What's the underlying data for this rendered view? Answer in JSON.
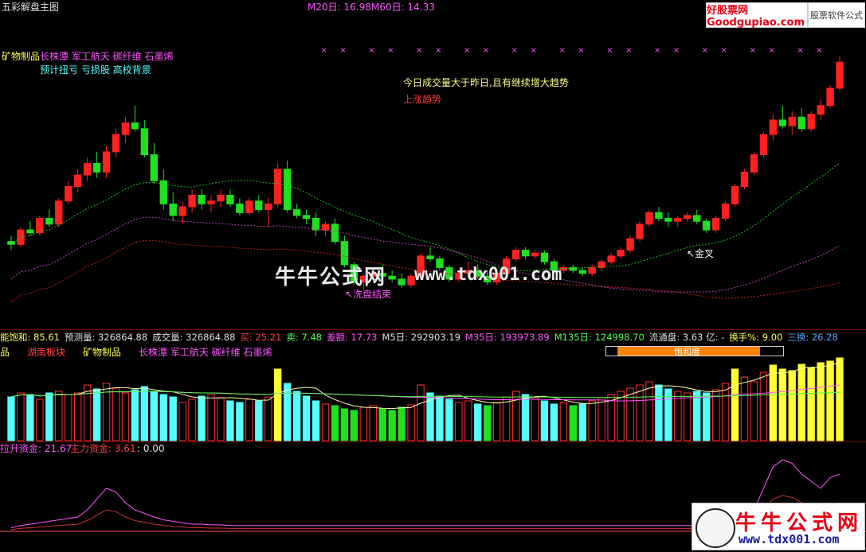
{
  "title": "五彩解盘主图",
  "header_ma": {
    "m20": "M20日: 16.98",
    "m60": "M60日: 14.33"
  },
  "banner": {
    "left": "好股票网Goodgupiao.com",
    "right": "股票软件公式"
  },
  "concepts1": {
    "first": "矿物制品",
    "rest": "长株潭 军工航天 碳纤维 石墨烯"
  },
  "concepts2": "预计扭亏 亏损股 高校背景",
  "notes": {
    "line1": "今日成交量大于昨日,且有继续增大趋势",
    "line2": "上涨趋势"
  },
  "annotations": {
    "wash": "↖洗盘结束",
    "golden": "↖金叉"
  },
  "watermark": {
    "cn": "牛牛公式网",
    "url": "www.tdx001.com"
  },
  "info_bar": [
    {
      "label": "能饱和: ",
      "value": "85.61",
      "color": "#ffff55"
    },
    {
      "label": "预测量: ",
      "value": "326864.88",
      "color": "#e0e0e0"
    },
    {
      "label": "成交量: ",
      "value": "326864.88",
      "color": "#e0e0e0"
    },
    {
      "label": "买: ",
      "value": "25.21",
      "color": "#ff4040"
    },
    {
      "label": "卖: ",
      "value": "7.48",
      "color": "#55ff55"
    },
    {
      "label": "差额: ",
      "value": "17.73",
      "color": "#ff55ff"
    },
    {
      "label": "M5日: ",
      "value": "292903.19",
      "color": "#e0e0e0"
    },
    {
      "label": "M35日: ",
      "value": "193973.89",
      "color": "#ff55ff"
    },
    {
      "label": "M135日: ",
      "value": "124998.70",
      "color": "#55ff55"
    },
    {
      "label": "流通盘: ",
      "value": "3.63 亿: -",
      "color": "#e0e0e0"
    },
    {
      "label": "换手%: ",
      "value": "9.00",
      "color": "#ffff55"
    },
    {
      "label": "三换: ",
      "value": "26.28",
      "color": "#55aaff"
    }
  ],
  "sector_bar": [
    {
      "text": "品",
      "color": "#ffff55"
    },
    {
      "text": "湖南板块",
      "color": "#ff4040"
    },
    {
      "text": "矿物制品",
      "color": "#ffff55"
    },
    {
      "text": "长株潭 军工航天 碳纤维 石墨烯",
      "color": "#ff55ff"
    }
  ],
  "saturation": {
    "label": "饱和度",
    "fill_fraction": 0.86
  },
  "fund_bar": {
    "a": "拉升资金: 21.67",
    "b": "主力资金: 3.61",
    "c": ": 0.00"
  },
  "colors": {
    "up": "#ff2020",
    "down": "#20e020",
    "ma20": "#20c020",
    "ma60": "#c040c0",
    "ma120": "#c02020"
  },
  "chart_data": {
    "type": "candlestick",
    "ma20": 16.98,
    "ma60": 14.33,
    "candles": [
      [
        13.1,
        13.3,
        12.8,
        13.0
      ],
      [
        13.0,
        13.6,
        12.9,
        13.5
      ],
      [
        13.5,
        13.8,
        13.3,
        13.4
      ],
      [
        13.4,
        14.0,
        13.3,
        13.9
      ],
      [
        13.9,
        14.2,
        13.6,
        13.7
      ],
      [
        13.7,
        14.6,
        13.6,
        14.5
      ],
      [
        14.5,
        15.2,
        14.4,
        15.0
      ],
      [
        15.0,
        15.6,
        14.8,
        15.4
      ],
      [
        15.4,
        16.0,
        15.2,
        15.8
      ],
      [
        15.8,
        16.2,
        15.3,
        15.5
      ],
      [
        15.5,
        16.4,
        15.3,
        16.2
      ],
      [
        16.2,
        17.0,
        16.0,
        16.8
      ],
      [
        16.8,
        17.4,
        16.5,
        17.2
      ],
      [
        17.2,
        17.8,
        16.9,
        17.0
      ],
      [
        17.0,
        17.3,
        16.0,
        16.1
      ],
      [
        16.1,
        16.5,
        15.1,
        15.2
      ],
      [
        15.2,
        15.6,
        14.2,
        14.4
      ],
      [
        14.4,
        14.8,
        13.8,
        14.0
      ],
      [
        14.0,
        14.5,
        13.7,
        14.3
      ],
      [
        14.3,
        14.9,
        14.1,
        14.7
      ],
      [
        14.7,
        14.9,
        14.2,
        14.4
      ],
      [
        14.4,
        14.7,
        14.1,
        14.5
      ],
      [
        14.5,
        14.9,
        14.3,
        14.7
      ],
      [
        14.7,
        14.9,
        14.3,
        14.4
      ],
      [
        14.4,
        14.6,
        14.0,
        14.1
      ],
      [
        14.1,
        14.6,
        14.0,
        14.5
      ],
      [
        14.5,
        14.7,
        14.1,
        14.2
      ],
      [
        14.2,
        14.6,
        13.6,
        14.4
      ],
      [
        14.4,
        15.8,
        14.3,
        15.6
      ],
      [
        15.6,
        15.9,
        14.1,
        14.2
      ],
      [
        14.2,
        14.4,
        13.9,
        14.0
      ],
      [
        14.0,
        14.2,
        13.7,
        13.9
      ],
      [
        13.9,
        14.1,
        13.3,
        13.5
      ],
      [
        13.5,
        13.8,
        13.3,
        13.7
      ],
      [
        13.7,
        13.9,
        13.0,
        13.1
      ],
      [
        13.1,
        13.3,
        12.2,
        12.3
      ],
      [
        12.3,
        12.4,
        11.6,
        11.7
      ],
      [
        11.7,
        12.0,
        11.4,
        11.9
      ],
      [
        11.9,
        12.2,
        11.8,
        12.0
      ],
      [
        12.0,
        12.3,
        11.9,
        11.9
      ],
      [
        11.9,
        12.1,
        11.7,
        11.8
      ],
      [
        11.8,
        12.0,
        11.5,
        11.6
      ],
      [
        11.6,
        12.0,
        11.5,
        11.9
      ],
      [
        11.9,
        12.7,
        11.8,
        12.6
      ],
      [
        12.6,
        12.9,
        12.4,
        12.5
      ],
      [
        12.5,
        12.6,
        12.1,
        12.2
      ],
      [
        12.2,
        12.3,
        11.7,
        11.8
      ],
      [
        11.8,
        12.1,
        11.7,
        12.0
      ],
      [
        12.0,
        12.4,
        11.9,
        12.1
      ],
      [
        12.1,
        12.3,
        11.8,
        11.9
      ],
      [
        11.9,
        12.1,
        11.6,
        11.7
      ],
      [
        11.7,
        12.1,
        11.6,
        12.0
      ],
      [
        12.0,
        12.6,
        11.9,
        12.5
      ],
      [
        12.5,
        12.9,
        12.4,
        12.8
      ],
      [
        12.8,
        12.9,
        12.5,
        12.6
      ],
      [
        12.6,
        12.8,
        12.5,
        12.7
      ],
      [
        12.7,
        12.8,
        12.3,
        12.4
      ],
      [
        12.4,
        12.5,
        12.0,
        12.1
      ],
      [
        12.1,
        12.3,
        12.0,
        12.2
      ],
      [
        12.2,
        12.3,
        12.0,
        12.1
      ],
      [
        12.1,
        12.2,
        11.9,
        12.0
      ],
      [
        12.0,
        12.3,
        11.9,
        12.2
      ],
      [
        12.2,
        12.5,
        12.1,
        12.4
      ],
      [
        12.4,
        12.7,
        12.3,
        12.6
      ],
      [
        12.6,
        12.9,
        12.5,
        12.8
      ],
      [
        12.8,
        13.3,
        12.7,
        13.2
      ],
      [
        13.2,
        13.8,
        13.1,
        13.7
      ],
      [
        13.7,
        14.2,
        13.6,
        14.1
      ],
      [
        14.1,
        14.3,
        13.8,
        13.9
      ],
      [
        13.9,
        14.1,
        13.6,
        13.8
      ],
      [
        13.8,
        14.0,
        13.6,
        13.9
      ],
      [
        13.9,
        14.1,
        13.8,
        14.0
      ],
      [
        14.0,
        14.2,
        13.7,
        13.8
      ],
      [
        13.8,
        13.9,
        13.4,
        13.5
      ],
      [
        13.5,
        14.0,
        13.4,
        13.9
      ],
      [
        13.9,
        14.5,
        13.8,
        14.4
      ],
      [
        14.4,
        15.1,
        14.3,
        15.0
      ],
      [
        15.0,
        15.6,
        14.9,
        15.5
      ],
      [
        15.5,
        16.2,
        15.4,
        16.1
      ],
      [
        16.1,
        16.9,
        16.0,
        16.8
      ],
      [
        16.8,
        17.5,
        16.6,
        17.3
      ],
      [
        17.3,
        17.8,
        17.0,
        17.1
      ],
      [
        17.1,
        17.6,
        16.8,
        17.4
      ],
      [
        17.4,
        17.7,
        16.9,
        17.0
      ],
      [
        17.0,
        17.6,
        16.9,
        17.5
      ],
      [
        17.5,
        18.0,
        17.3,
        17.8
      ],
      [
        17.8,
        18.5,
        17.7,
        18.4
      ],
      [
        18.4,
        19.5,
        18.3,
        19.3
      ]
    ],
    "volume": [
      55,
      60,
      58,
      52,
      60,
      62,
      58,
      60,
      70,
      65,
      72,
      66,
      60,
      64,
      68,
      62,
      58,
      55,
      48,
      52,
      56,
      58,
      54,
      50,
      48,
      52,
      50,
      55,
      90,
      72,
      62,
      56,
      50,
      46,
      44,
      40,
      38,
      42,
      44,
      40,
      38,
      42,
      45,
      70,
      60,
      56,
      52,
      48,
      50,
      46,
      44,
      48,
      55,
      62,
      58,
      54,
      50,
      46,
      48,
      44,
      46,
      50,
      54,
      58,
      62,
      66,
      70,
      74,
      70,
      65,
      62,
      60,
      62,
      60,
      64,
      72,
      90,
      80,
      74,
      86,
      95,
      90,
      88,
      96,
      92,
      98,
      100,
      104
    ],
    "fund_main": [
      5,
      8,
      10,
      12,
      14,
      16,
      18,
      20,
      30,
      45,
      60,
      55,
      40,
      30,
      25,
      20,
      16,
      14,
      12,
      10,
      10,
      9,
      9,
      8,
      8,
      8,
      8,
      8,
      8,
      8,
      8,
      8,
      8,
      8,
      8,
      8,
      8,
      8,
      8,
      8,
      8,
      8,
      8,
      8,
      8,
      8,
      8,
      8,
      8,
      8,
      8,
      8,
      8,
      8,
      8,
      8,
      8,
      8,
      8,
      8,
      8,
      8,
      8,
      8,
      8,
      8,
      8,
      8,
      8,
      8,
      8,
      8,
      8,
      10,
      12,
      14,
      16,
      20,
      30,
      60,
      90,
      100,
      95,
      80,
      70,
      60,
      75,
      80
    ]
  }
}
